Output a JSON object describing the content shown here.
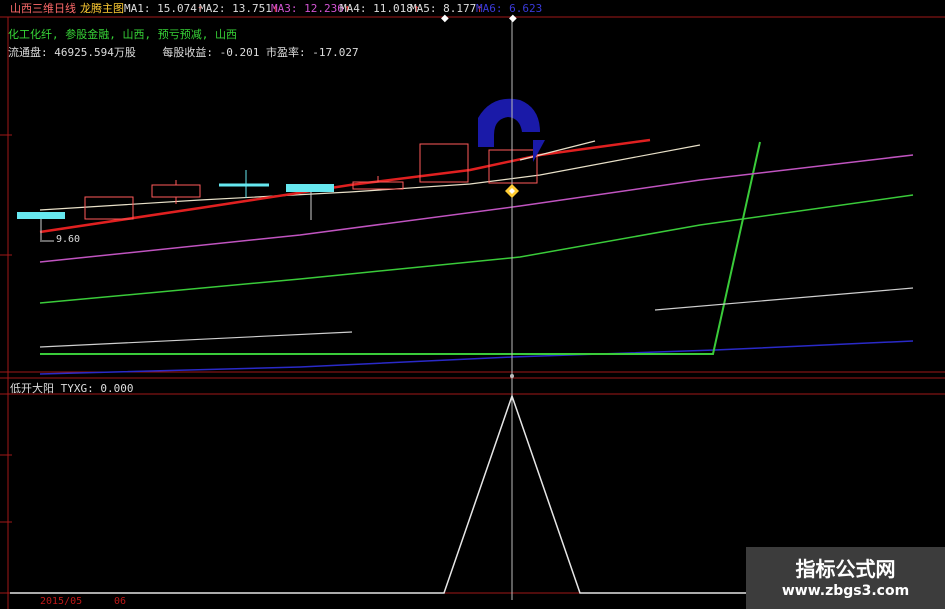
{
  "header": {
    "stock_name": "山西三维日线",
    "indicator_name": "龙腾主图",
    "ma_items": [
      {
        "label": "MA1: 15.074",
        "arrow": "↑"
      },
      {
        "label": "MA2: 13.751",
        "arrow": "↑"
      },
      {
        "label": "MA3: 12.236",
        "arrow": "↑"
      },
      {
        "label": "MA4: 11.018",
        "arrow": "↑"
      },
      {
        "label": "MA5: 8.177",
        "arrow": "↑"
      },
      {
        "label": "MA6: 6.623",
        "arrow": ""
      }
    ]
  },
  "concepts": "化工化纤, 参股金融, 山西, 预亏预减, 山西",
  "info": {
    "float_shares": "流通盘: 46925.594万股",
    "eps_pe": "每股收益: -0.201 市盈率: -17.027"
  },
  "price_label": "9.60",
  "sub_chart": {
    "title": "低开大阳 TYXG: 0.000"
  },
  "date_label": "2015/05",
  "date_extra": "06",
  "watermark": {
    "title": "指标公式网",
    "url": "www.zbgs3.com"
  },
  "colors": {
    "background": "#000000",
    "frame": "#a01818",
    "ma_up": "#ff3b3b",
    "ma3": "#d154d1",
    "ma6": "#3a3ad8",
    "concept_text": "#37d437",
    "candle_up": "#ff5a5a",
    "candle_down": "#66e8f0",
    "marker_blue": "#1a1aa8"
  },
  "icons": [
    "crosshair-icon",
    "diamond-signal-icon",
    "blue-arc-marker-icon"
  ]
}
